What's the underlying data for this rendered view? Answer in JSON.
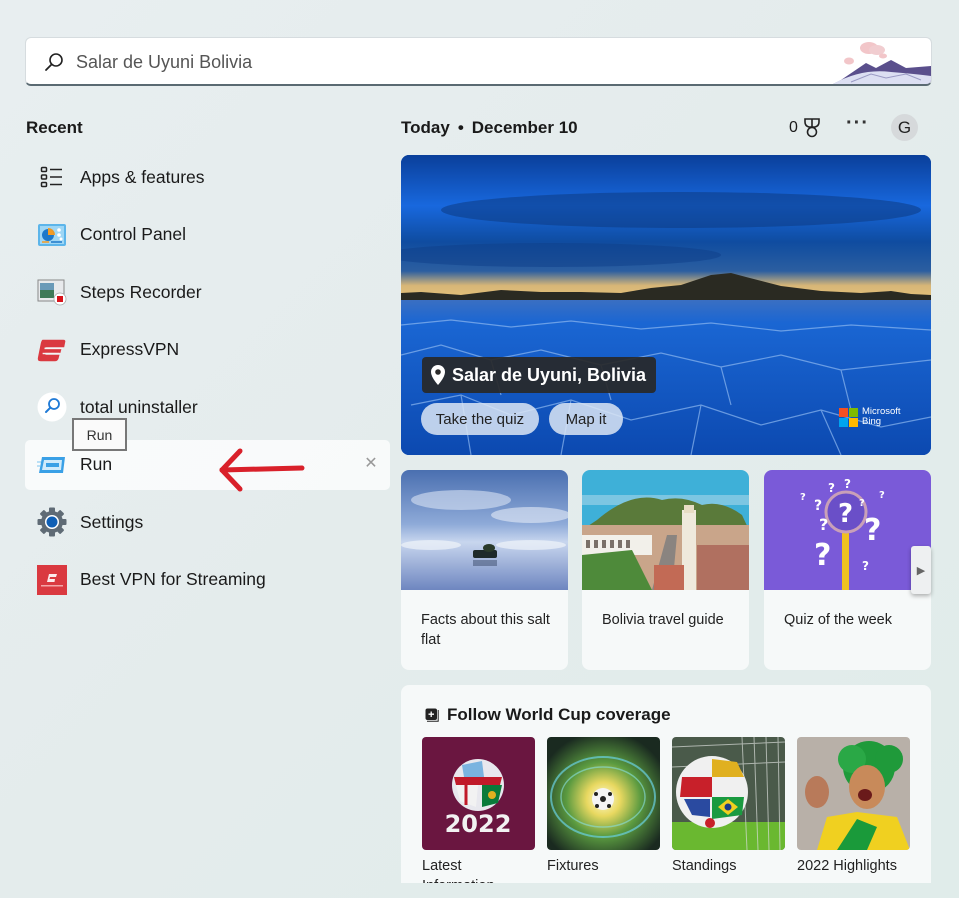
{
  "search": {
    "value": "Salar de Uyuni Bolivia",
    "icon": "search-icon"
  },
  "recent": {
    "title": "Recent",
    "items": [
      {
        "label": "Apps & features",
        "icon": "list-icon"
      },
      {
        "label": "Control Panel",
        "icon": "control-panel-icon"
      },
      {
        "label": "Steps Recorder",
        "icon": "steps-recorder-icon"
      },
      {
        "label": "ExpressVPN",
        "icon": "expressvpn-icon"
      },
      {
        "label": "total uninstaller",
        "icon": "search-icon"
      },
      {
        "label": "Run",
        "icon": "run-icon",
        "active": true
      },
      {
        "label": "Settings",
        "icon": "gear-icon"
      },
      {
        "label": "Best VPN for Streaming",
        "icon": "expressvpn-web-icon"
      }
    ],
    "tooltip": "Run",
    "remove_glyph": "✕"
  },
  "header": {
    "today": "Today",
    "separator": "•",
    "date": "December 10",
    "points": "0",
    "more": "···",
    "avatar_initial": "G"
  },
  "hero": {
    "location": "Salar de Uyuni, Bolivia",
    "quiz_label": "Take the quiz",
    "map_label": "Map it",
    "brand_line1": "Microsoft",
    "brand_line2": "Bing"
  },
  "cards": [
    {
      "caption": "Facts about this salt flat"
    },
    {
      "caption": "Bolivia travel guide"
    },
    {
      "caption": "Quiz of the week"
    }
  ],
  "worldcup": {
    "title": "Follow World Cup coverage",
    "tiles": [
      {
        "label": "Latest Information",
        "overlay": "2022"
      },
      {
        "label": "Fixtures"
      },
      {
        "label": "Standings"
      },
      {
        "label": "2022 Highlights"
      }
    ]
  },
  "colors": {
    "accent_red": "#d9202a",
    "hero_blue": "#1563d8",
    "wc_maroon": "#6a1640"
  }
}
